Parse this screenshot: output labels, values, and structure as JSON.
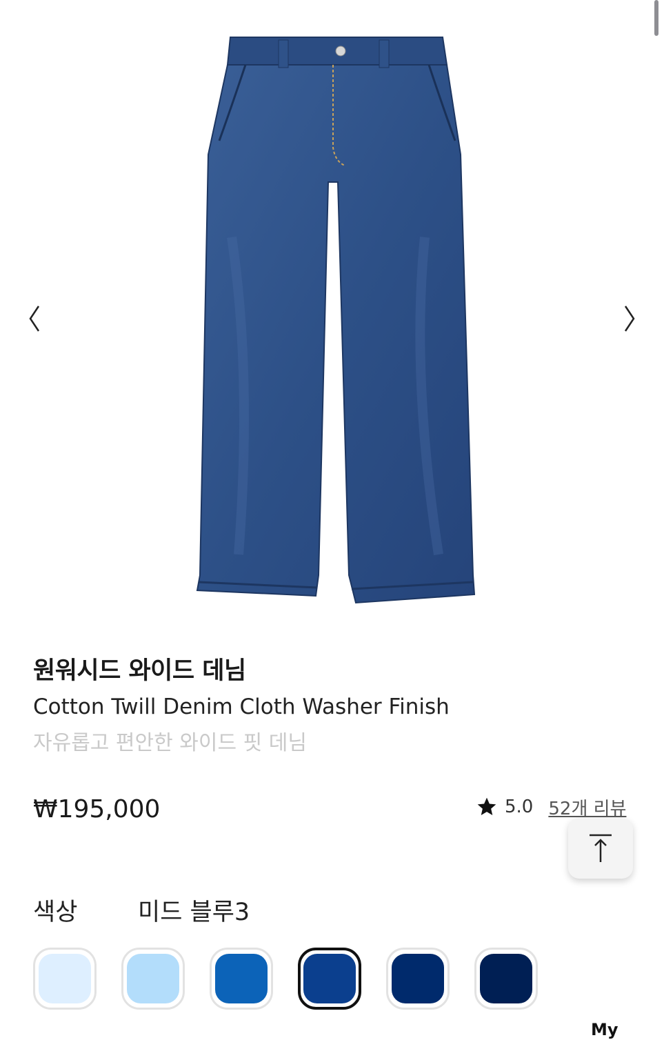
{
  "gallery": {
    "prev_icon": "chevron-left-icon",
    "next_icon": "chevron-right-icon"
  },
  "product": {
    "name_ko": "원워시드 와이드 데님",
    "name_en": "Cotton Twill Denim Cloth Washer Finish",
    "description": "자유롭고 편안한 와이드 핏 데님",
    "price": "₩195,000",
    "rating": "5.0",
    "reviews": "52개 리뷰",
    "rating_icon": "star-icon"
  },
  "scroll_top": {
    "icon": "arrow-up-to-top-icon"
  },
  "options": {
    "color_label": "색상",
    "color_value": "미드 블루3",
    "swatches": [
      {
        "color": "#deefff"
      },
      {
        "color": "#b3ddfb"
      },
      {
        "color": "#0c63b8"
      },
      {
        "color": "#0b3f8e",
        "selected": true
      },
      {
        "color": "#002a6c"
      },
      {
        "color": "#001f54"
      }
    ]
  },
  "bottom_nav": {
    "my_label": "My"
  },
  "colors": {
    "denim": "#2d5087",
    "denim_dark": "#213e6e",
    "text": "#1a1a1a",
    "muted": "#c9c9c9"
  }
}
